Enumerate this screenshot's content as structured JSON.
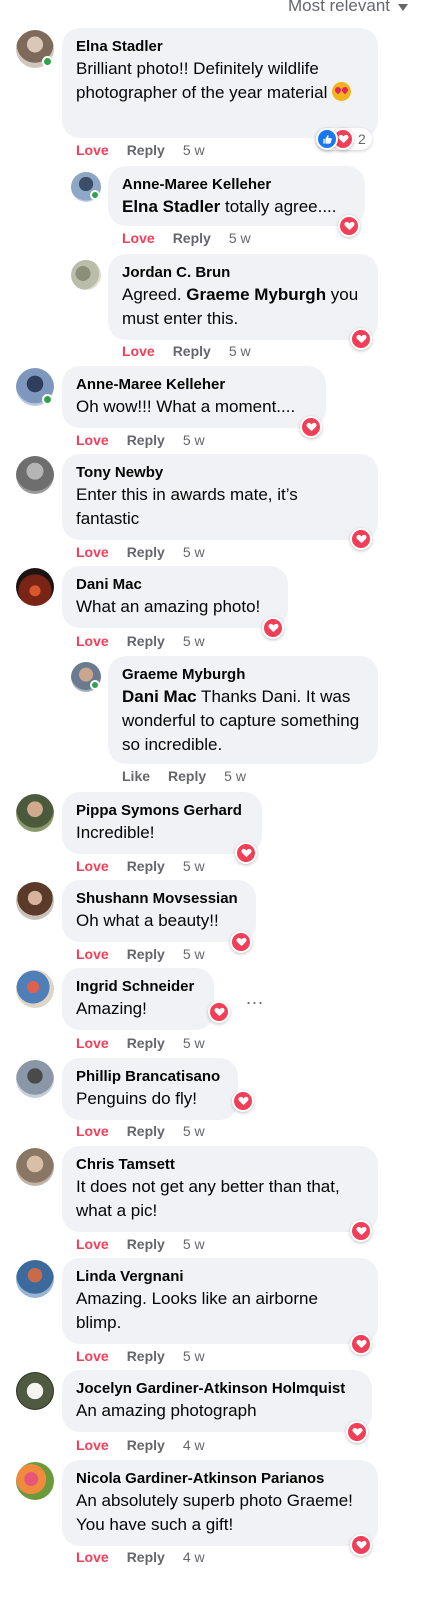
{
  "sort": {
    "label": "Most relevant"
  },
  "colors": {
    "love": "#f33e58",
    "meta": "#65676b",
    "bubble": "#f0f2f5",
    "online": "#31a24c",
    "like": "#1877f2"
  },
  "comments": [
    {
      "name": "Elna Stadler",
      "text": "Brilliant photo!! Definitely wildlife photographer of the year material",
      "reaction": "Love",
      "reply": "Reply",
      "time": "5 w",
      "reaction_count": "2"
    },
    {
      "name": "Anne-Maree Kelleher",
      "mention": "Elna Stadler",
      "text": " totally agree....",
      "reaction": "Love",
      "reply": "Reply",
      "time": "5 w"
    },
    {
      "name": "Jordan C. Brun",
      "text_a": "Agreed. ",
      "mention": "Graeme Myburgh",
      "text_b": " you must enter this.",
      "reaction": "Love",
      "reply": "Reply",
      "time": "5 w"
    },
    {
      "name": "Anne-Maree Kelleher",
      "text": "Oh wow!!! What a moment....",
      "reaction": "Love",
      "reply": "Reply",
      "time": "5 w"
    },
    {
      "name": "Tony Newby",
      "text": "Enter this in awards mate, it’s fantastic",
      "reaction": "Love",
      "reply": "Reply",
      "time": "5 w"
    },
    {
      "name": "Dani Mac",
      "text": "What an amazing photo!",
      "reaction": "Love",
      "reply": "Reply",
      "time": "5 w"
    },
    {
      "name": "Graeme Myburgh",
      "mention": "Dani Mac",
      "text": " Thanks Dani. It was wonderful to capture something so incredible.",
      "reaction": "Like",
      "reply": "Reply",
      "time": "5 w"
    },
    {
      "name": "Pippa Symons Gerhard",
      "text": "Incredible!",
      "reaction": "Love",
      "reply": "Reply",
      "time": "5 w"
    },
    {
      "name": "Shushann Movsessian",
      "text": "Oh what a beauty!!",
      "reaction": "Love",
      "reply": "Reply",
      "time": "5 w"
    },
    {
      "name": "Ingrid Schneider",
      "text": "Amazing!",
      "reaction": "Love",
      "reply": "Reply",
      "time": "5 w",
      "more": "..."
    },
    {
      "name": "Phillip Brancatisano",
      "text": "Penguins do fly!",
      "reaction": "Love",
      "reply": "Reply",
      "time": "5 w"
    },
    {
      "name": "Chris Tamsett",
      "text": "It does not get any better than that, what a pic!",
      "reaction": "Love",
      "reply": "Reply",
      "time": "5 w"
    },
    {
      "name": "Linda Vergnani",
      "text": "Amazing. Looks like an airborne blimp.",
      "reaction": "Love",
      "reply": "Reply",
      "time": "5 w"
    },
    {
      "name": "Jocelyn Gardiner-Atkinson Holmquist",
      "text": "An amazing photograph",
      "reaction": "Love",
      "reply": "Reply",
      "time": "4 w"
    },
    {
      "name": "Nicola Gardiner-Atkinson Parianos",
      "text": "An absolutely superb photo Graeme! You have such a gift!",
      "reaction": "Love",
      "reply": "Reply",
      "time": "4 w"
    }
  ]
}
